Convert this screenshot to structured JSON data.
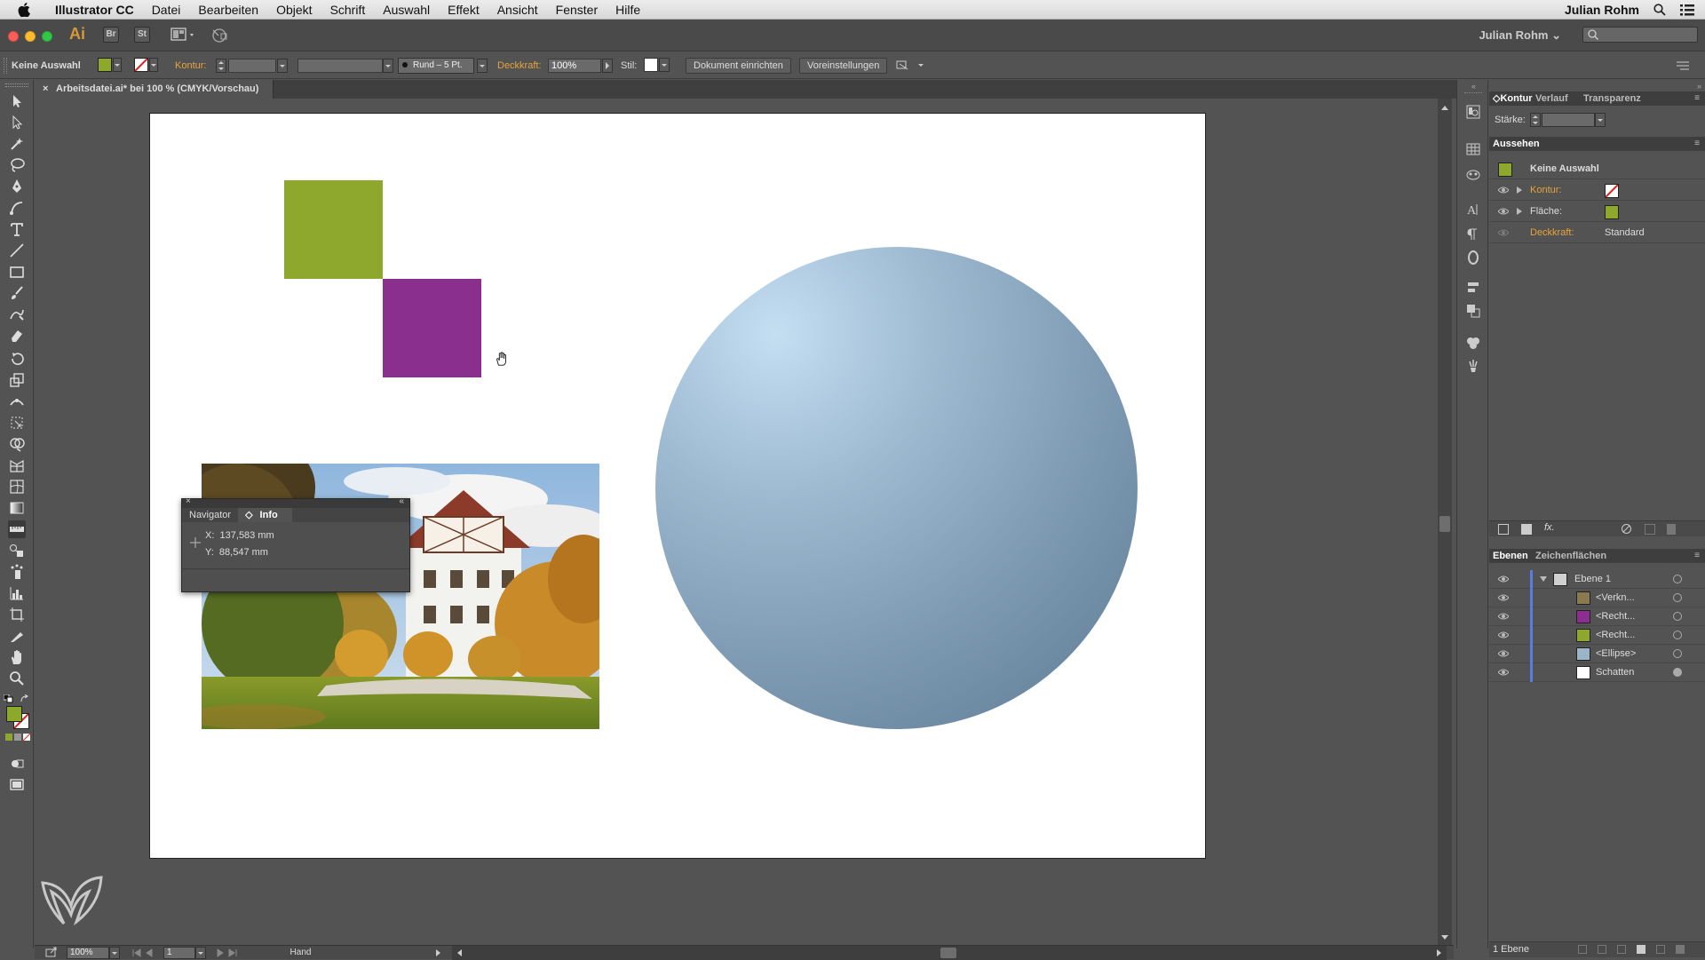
{
  "menubar": {
    "app_name": "Illustrator CC",
    "items": [
      "Datei",
      "Bearbeiten",
      "Objekt",
      "Schrift",
      "Auswahl",
      "Effekt",
      "Ansicht",
      "Fenster",
      "Hilfe"
    ],
    "user": "Julian Rohm"
  },
  "appbar": {
    "logo": "Ai",
    "bridge": "Br",
    "stock": "St",
    "user": "Julian Rohm",
    "user_chevron": "⌄"
  },
  "controlbar": {
    "selection": "Keine Auswahl",
    "kontur_label": "Kontur:",
    "brush": "Rund – 5 Pt.",
    "deckkraft_label": "Deckkraft:",
    "deckkraft_value": "100%",
    "stil_label": "Stil:",
    "doc_setup_btn": "Dokument einrichten",
    "prefs_btn": "Voreinstellungen",
    "fill_color": "#8ea82e"
  },
  "document": {
    "tab_title": "Arbeitsdatei.ai* bei 100 % (CMYK/Vorschau)",
    "close": "×"
  },
  "artwork": {
    "green": "#8ea82e",
    "purple": "#8b2f8f",
    "sphere_light": "#c4def2",
    "sphere_dark": "#5c7a92"
  },
  "info_panel": {
    "tab_navigator": "Navigator",
    "tab_info": "Info",
    "x_label": "X:",
    "x_value": "137,583 mm",
    "y_label": "Y:",
    "y_value": "88,547 mm"
  },
  "status": {
    "zoom": "100%",
    "page": "1",
    "tool": "Hand"
  },
  "panels": {
    "kontur_tabs": [
      "Kontur",
      "Verlauf",
      "Transparenz"
    ],
    "staerke_label": "Stärke:",
    "aussehen_title": "Aussehen",
    "aussehen_selection": "Keine Auswahl",
    "kontur_row": "Kontur:",
    "flaeche_row": "Fläche:",
    "deckkraft_row": "Deckkraft:",
    "deckkraft_value": "Standard",
    "fx_label": "fx.",
    "layers_tabs": [
      "Ebenen",
      "Zeichenflächen"
    ],
    "layers": [
      {
        "name": "Ebene 1",
        "thumb": "#d0d0d0"
      },
      {
        "name": "<Verkn...",
        "thumb": "#8a7a50"
      },
      {
        "name": "<Recht...",
        "thumb": "#8b2f8f"
      },
      {
        "name": "<Recht...",
        "thumb": "#8ea82e"
      },
      {
        "name": "<Ellipse>",
        "thumb": "#9ab4c8"
      },
      {
        "name": "Schatten",
        "thumb": "#ffffff"
      }
    ],
    "layers_footer": "1 Ebene"
  }
}
